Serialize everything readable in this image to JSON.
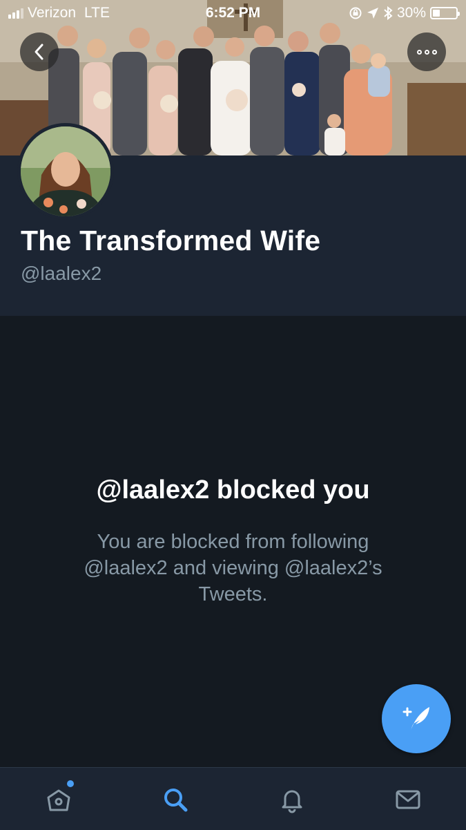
{
  "status_bar": {
    "carrier": "Verizon",
    "network": "LTE",
    "time": "6:52 PM",
    "battery": "30%",
    "battery_level": 0.3
  },
  "header": {
    "back_icon": "chevron-left-icon",
    "more_icon": "more-dots-icon"
  },
  "profile": {
    "name": "The Transformed Wife",
    "handle": "@laalex2"
  },
  "blocked": {
    "title": "@laalex2 blocked you",
    "description": "You are blocked from following @laalex2 and viewing @laalex2’s Tweets."
  },
  "tabs": [
    {
      "name": "home",
      "icon": "home-icon",
      "badge": true
    },
    {
      "name": "search",
      "icon": "search-icon",
      "active": true
    },
    {
      "name": "notifications",
      "icon": "bell-icon"
    },
    {
      "name": "messages",
      "icon": "envelope-icon"
    }
  ],
  "colors": {
    "background": "#141a21",
    "panel": "#1c2533",
    "accent": "#4a9ff5",
    "muted_text": "#8899a6"
  }
}
